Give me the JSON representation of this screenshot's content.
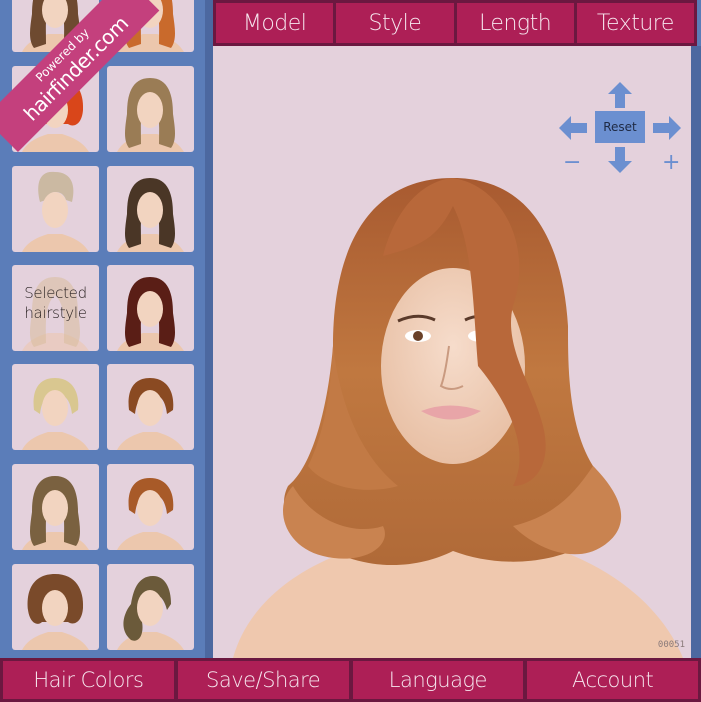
{
  "branding": {
    "powered_by": "Powered by",
    "site": "hairfinder.com"
  },
  "top_nav": [
    {
      "label": "Model",
      "id": "model"
    },
    {
      "label": "Style",
      "id": "style"
    },
    {
      "label": "Length",
      "id": "length"
    },
    {
      "label": "Texture",
      "id": "texture"
    }
  ],
  "bottom_nav": [
    {
      "label": "Hair Colors",
      "id": "hair-colors"
    },
    {
      "label": "Save/Share",
      "id": "save-share"
    },
    {
      "label": "Language",
      "id": "language"
    },
    {
      "label": "Account",
      "id": "account"
    }
  ],
  "controls": {
    "reset_label": "Reset",
    "zoom_out_symbol": "−",
    "zoom_in_symbol": "+",
    "arrow_up": "move-up",
    "arrow_down": "move-down",
    "arrow_left": "move-left",
    "arrow_right": "move-right"
  },
  "stage": {
    "style_code": "00051"
  },
  "thumbnails": [
    {
      "hair": "#6e4a30",
      "style": "partial",
      "selected": false
    },
    {
      "hair": "#c96a2c",
      "style": "long-wavy",
      "selected": false
    },
    {
      "hair": "#d9461a",
      "style": "curly-short",
      "selected": false
    },
    {
      "hair": "#9a7c55",
      "style": "long-straight-bangs",
      "selected": false
    },
    {
      "hair": "#cbb9a2",
      "style": "pompadour",
      "selected": false
    },
    {
      "hair": "#4a3626",
      "style": "medium-wavy",
      "selected": false
    },
    {
      "hair": "#d9bd9c",
      "style": "medium-flip",
      "selected": true,
      "label": "Selected hairstyle"
    },
    {
      "hair": "#5a1e16",
      "style": "layered-long",
      "selected": false
    },
    {
      "hair": "#d9c790",
      "style": "pixie-blonde",
      "selected": false
    },
    {
      "hair": "#8a4a22",
      "style": "short-tousled",
      "selected": false
    },
    {
      "hair": "#7a6140",
      "style": "medium-curly",
      "selected": false
    },
    {
      "hair": "#a85a28",
      "style": "bowl-bob",
      "selected": false
    },
    {
      "hair": "#7a4a2a",
      "style": "curly-bob",
      "selected": false
    },
    {
      "hair": "#6b5a3a",
      "style": "side-swept-curls",
      "selected": false
    }
  ],
  "colors": {
    "accent": "#ad1f56",
    "accent_dark": "#6b1840",
    "sidebar": "#5b7db9",
    "stage_bg": "#e4d1dc",
    "control_blue": "#6b8fd0",
    "ribbon": "#c4407d",
    "main_hair": "#b4683a",
    "skin": "#f1cdb3"
  }
}
